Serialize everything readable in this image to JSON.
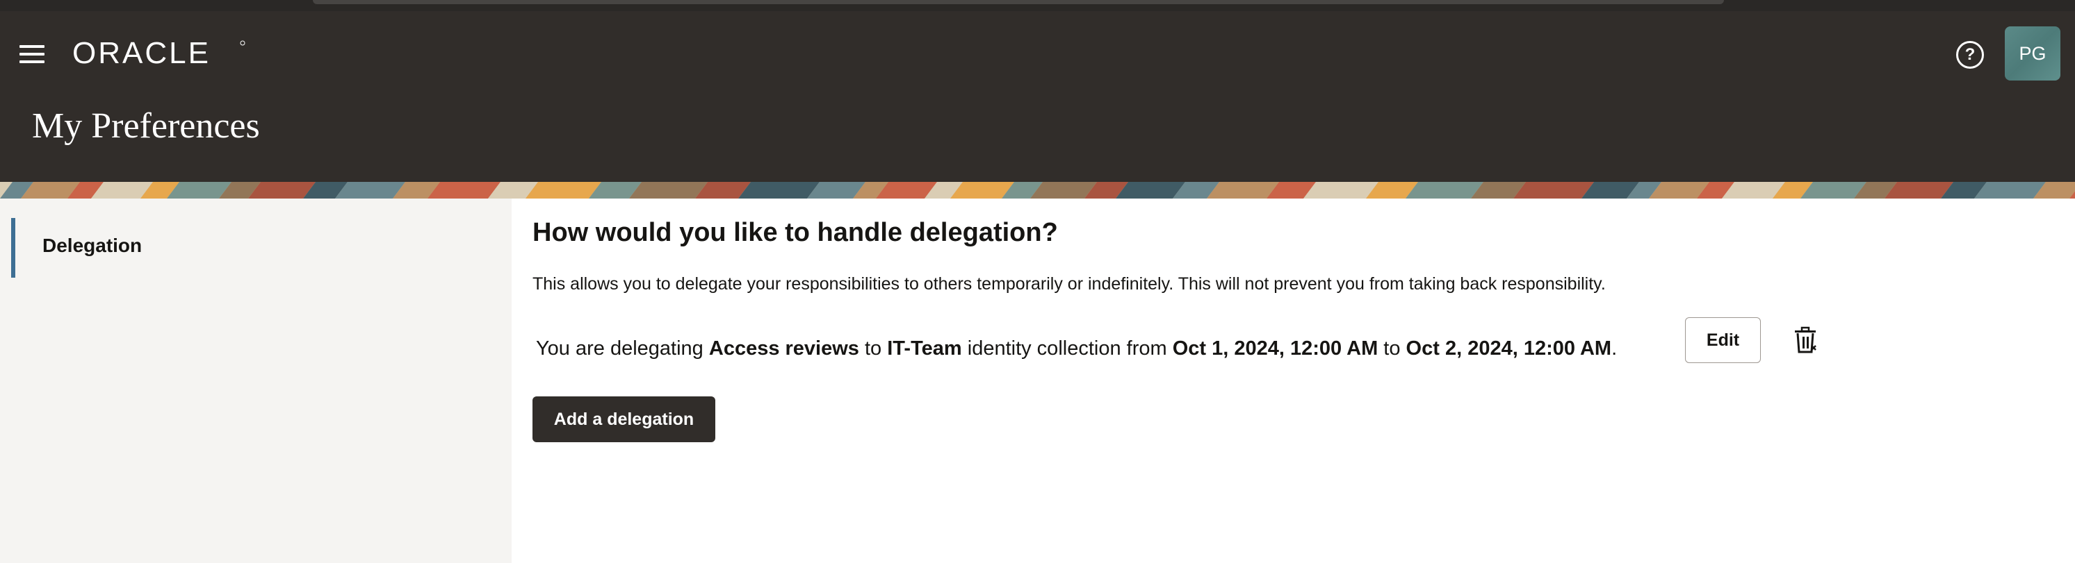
{
  "header": {
    "logo_text": "ORACLE",
    "page_title": "My Preferences",
    "avatar_initials": "PG",
    "help_icon_glyph": "?",
    "colors": {
      "header_bg": "#312d2a",
      "accent": "#3e6f94",
      "avatar_bg": "#5b8a88"
    }
  },
  "sidebar": {
    "items": [
      {
        "label": "Delegation",
        "selected": true
      }
    ]
  },
  "main": {
    "heading": "How would you like to handle delegation?",
    "description": "This allows you to delegate your responsibilities to others temporarily or indefinitely. This will not prevent you from taking back responsibility.",
    "delegation": {
      "prefix": "You are delegating ",
      "task": "Access reviews",
      "to_word": " to ",
      "delegate": "IT-Team",
      "collection_text": " identity collection from ",
      "start": "Oct 1, 2024, 12:00 AM",
      "to_word2": " to ",
      "end": "Oct 2, 2024, 12:00 AM",
      "period": "."
    },
    "edit_label": "Edit",
    "delete_icon": "trash-icon",
    "add_button_label": "Add a delegation"
  }
}
